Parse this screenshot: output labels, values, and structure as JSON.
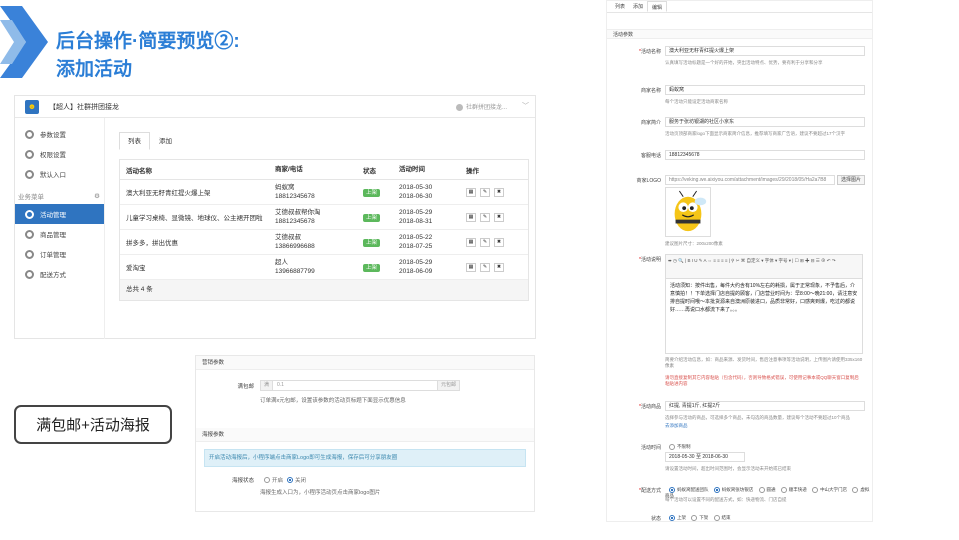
{
  "slide": {
    "title_line1": "后台操作·简要预览②:",
    "title_line2": "添加活动",
    "tag_label": "满包邮+活动海报"
  },
  "admin": {
    "shop_name": "【超人】社群拼团接龙",
    "shop_right": "社群拼团接龙...",
    "sidebar": {
      "items_top": [
        {
          "label": "参数设置",
          "icon": "gear-icon"
        },
        {
          "label": "权限设置",
          "icon": "gear-icon"
        },
        {
          "label": "默认入口",
          "icon": "gear-icon"
        }
      ],
      "group_label": "业务菜单",
      "items_biz": [
        {
          "label": "活动管理",
          "icon": "gear-icon",
          "active": true
        },
        {
          "label": "商品管理",
          "icon": "gear-icon"
        },
        {
          "label": "订单管理",
          "icon": "gear-icon"
        },
        {
          "label": "配送方式",
          "icon": "gear-icon"
        }
      ]
    },
    "tabs": [
      "列表",
      "添加"
    ],
    "table": {
      "headers": [
        "活动名称",
        "商家/电话",
        "状态",
        "活动时间",
        "操作"
      ],
      "rows": [
        {
          "name": "澳大利亚无籽青红提火爆上架",
          "merchant": "蚂蚁窝",
          "phone": "18812345678",
          "status": "上架",
          "start": "2018-05-30",
          "end": "2018-06-30"
        },
        {
          "name": "儿童学习桌椅、显微镜、地球仪、公主裙开团啦",
          "merchant": "艾德叔叔帮你淘",
          "phone": "18812345678",
          "status": "上架",
          "start": "2018-05-29",
          "end": "2018-08-31"
        },
        {
          "name": "拼多多，拼出优惠",
          "merchant": "艾德叔叔",
          "phone": "13866996688",
          "status": "上架",
          "start": "2018-05-22",
          "end": "2018-07-25"
        },
        {
          "name": "爱淘宝",
          "merchant": "超人",
          "phone": "13966887799",
          "status": "上架",
          "start": "2018-05-29",
          "end": "2018-06-09"
        }
      ],
      "footer": "总共 4 条"
    }
  },
  "mid_panel": {
    "sec1": "营销参数",
    "free_ship_label": "满包邮",
    "free_ship_prefix": "满",
    "free_ship_value": "0.1",
    "free_ship_suffix": "元包邮",
    "free_ship_hint": "订单满x元包邮，设置该参数的活动页标题下面显示优惠信息",
    "sec2": "海报参数",
    "alert": "开启活动海报后，小程序端点击商家Logo即可生成海报，保存后可分享朋友圈",
    "poster_label": "海报状态",
    "poster_on": "开启",
    "poster_off": "关闭",
    "poster_hint": "海报生成入口为，小程序活动页点击商家logo图片"
  },
  "right_panel": {
    "tabs": [
      "列表",
      "添加",
      "编辑"
    ],
    "section": "活动参数",
    "f_name_label": "活动名称",
    "f_name_value": "澳大利亚无籽青红提火爆上架",
    "f_name_hint": "认真填写活动标题是一个好的开始，突出活动特点、优势，要有利于分享和分享",
    "f_merchant_label": "商家名称",
    "f_merchant_value": "蚂蚁窝",
    "f_merchant_hint": "每个活动只能设定活动商家名称",
    "f_intro_label": "商家简介",
    "f_intro_value": "服务于张坊银湖的社区小京东",
    "f_intro_hint": "活动页顶部商家logo下面显示商家简介信息，推荐填写商家广告语，建议不要超过17个汉字",
    "f_phone_label": "客服电话",
    "f_phone_value": "18812345678",
    "f_logo_label": "商家LOGO",
    "f_logo_value": "https://veking.we.aixiyou.com/attachment/images/29/2018/05/Ha2a7B8",
    "f_logo_btn": "选择图片",
    "f_logo_hint": "建议图片尺寸：200x200像素",
    "f_desc_label": "活动说明",
    "editor_tools": "⬌ ◷ 🔍 | B I U ✎ A ⇔ ≡ ≡ ≡ ≡ | ⚲ ✂ ⌘ 自定义 ▾ 字体 ▾ 字号 ▾ | ☐ ⊞ ✚ ⊟ ☰ ⊕ ↶ ↷",
    "editor_text": "活动须知：按件出售，每件大约含有10%左右的耗损，属于正常现象，不予售后，介意慎拍！！下单选择门店自提的顾客，门店营业时间为：早8:00～晚21:00，请注意安排自提时间哦～本批货源来自澳洲原装进口，品质非常好，口感爽到爆，吃过的都说好……再说口水都流下来了。。。",
    "f_desc_hint": "简要介绍活动信息，如：商品来源、发货时间，售后注意事项等活动说明，上传图片请使用335x160像素",
    "f_desc_warn": "请勿直接复制其它内容粘贴（包含代码），否则导致格式错误，可使用记事本或QQ聊天窗口复制后粘贴进内容",
    "f_goods_label": "活动商品",
    "f_goods_value": "红提, 青提1斤, 红提2斤",
    "f_goods_hint": "选择参与活动的商品，可选择多个商品，未勾选的商品数量，建议每个活动不要超过10个商品",
    "f_goods_link": "去添加商品",
    "f_time_label": "活动时间",
    "f_time_opt": "不限制",
    "f_time_value": "2018-05-30 至 2018-06-30",
    "f_time_hint": "请设置活动时间，超出时间范围时，会显示活动未开始或已结束",
    "f_ship_label": "配送方式",
    "f_ship_opts": [
      "蚂蚁窝配送团队",
      "蚂蚁窝张坊银店",
      "圆通",
      "顺丰快递",
      "中山大学门店",
      "虚拟商品"
    ],
    "f_ship_hint": "每个活动可以设置不同的配送方式，如：快递物流、门店自提",
    "f_status_label": "状态",
    "f_status_opts": [
      "上架",
      "下架",
      "结束"
    ]
  }
}
